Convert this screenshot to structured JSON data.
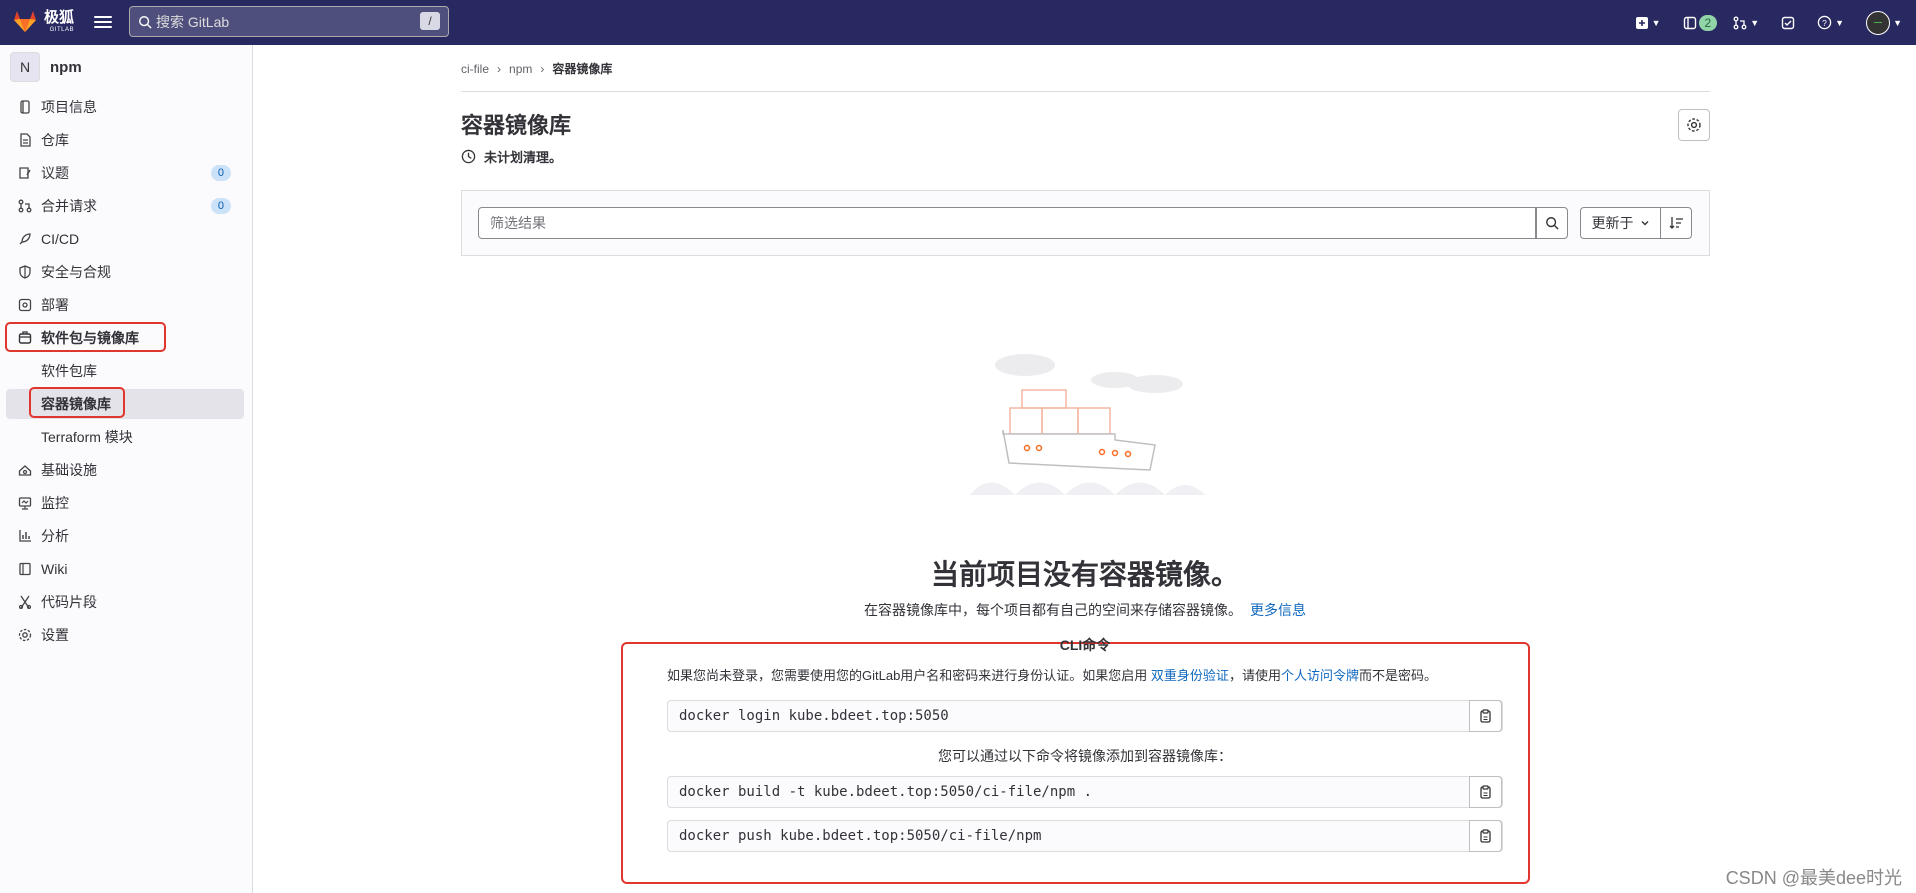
{
  "topbar": {
    "brand": "极狐",
    "brand_sub": "GITLAB",
    "search_placeholder": "搜索 GitLab",
    "search_shortcut": "/",
    "mr_count": "2"
  },
  "sidebar": {
    "project_initial": "N",
    "project_name": "npm",
    "items": [
      {
        "label": "项目信息",
        "icon": "info-icon"
      },
      {
        "label": "仓库",
        "icon": "repo-icon"
      },
      {
        "label": "议题",
        "icon": "issues-icon",
        "count": "0"
      },
      {
        "label": "合并请求",
        "icon": "merge-request-icon",
        "count": "0"
      },
      {
        "label": "CI/CD",
        "icon": "rocket-icon"
      },
      {
        "label": "安全与合规",
        "icon": "shield-icon"
      },
      {
        "label": "部署",
        "icon": "deploy-icon"
      },
      {
        "label": "软件包与镜像库",
        "icon": "package-icon"
      },
      {
        "label": "基础设施",
        "icon": "cloud-icon"
      },
      {
        "label": "监控",
        "icon": "monitor-icon"
      },
      {
        "label": "分析",
        "icon": "chart-icon"
      },
      {
        "label": "Wiki",
        "icon": "book-icon"
      },
      {
        "label": "代码片段",
        "icon": "snippet-icon"
      },
      {
        "label": "设置",
        "icon": "gear-icon"
      }
    ],
    "subitems": [
      {
        "label": "软件包库"
      },
      {
        "label": "容器镜像库"
      },
      {
        "label": "Terraform 模块"
      }
    ]
  },
  "breadcrumb": [
    "ci-file",
    "npm",
    "容器镜像库"
  ],
  "page": {
    "title": "容器镜像库",
    "cleanup_status": "未计划清理。"
  },
  "filter": {
    "placeholder": "筛选结果",
    "sort_label": "更新于"
  },
  "empty": {
    "title": "当前项目没有容器镜像。",
    "desc": "在容器镜像库中，每个项目都有自己的空间来存储容器镜像。",
    "more_link": "更多信息"
  },
  "cli": {
    "title": "CLI命令",
    "note_pre": "如果您尚未登录，您需要使用您的GitLab用户名和密码来进行身份认证。如果您启用 ",
    "note_link1": "双重身份验证",
    "note_mid": "，请使用",
    "note_link2": "个人访问令牌",
    "note_post": "而不是密码。",
    "login_cmd": "docker login kube.bdeet.top:5050",
    "mid_text": "您可以通过以下命令将镜像添加到容器镜像库：",
    "build_cmd": "docker build -t kube.bdeet.top:5050/ci-file/npm .",
    "push_cmd": "docker push kube.bdeet.top:5050/ci-file/npm"
  },
  "watermark": "CSDN @最美dee时光"
}
